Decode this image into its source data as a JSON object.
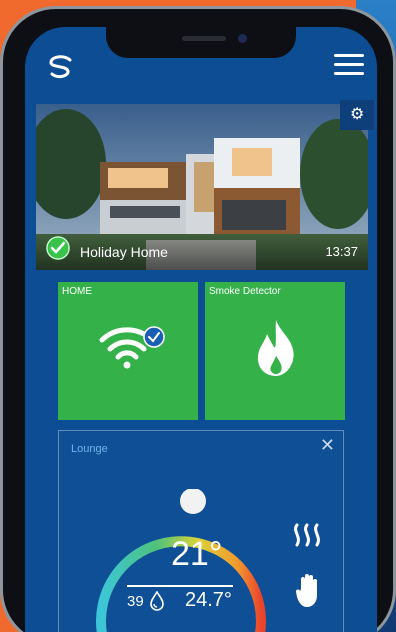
{
  "header": {
    "logo_icon": "s-logo-icon",
    "menu_icon": "hamburger-menu-icon",
    "settings_icon": "gear-icon"
  },
  "home": {
    "title": "Holiday Home",
    "time": "13:37",
    "status_icon": "check-circle-icon"
  },
  "tiles": [
    {
      "title": "HOME",
      "icon": "wifi-connected-icon"
    },
    {
      "title": "Smoke Detector",
      "icon": "flame-icon"
    }
  ],
  "lounge": {
    "title": "Lounge",
    "close_icon": "close-icon",
    "temperature": "21°",
    "humidity": "39",
    "humidity_icon": "water-drop-icon",
    "setpoint": "24.7°",
    "heat_icon": "heating-icon",
    "manual_icon": "hand-icon"
  },
  "colors": {
    "brand_blue": "#0d4d93",
    "tile_green": "#35b14a",
    "accent_orange": "#ef6a2c"
  }
}
